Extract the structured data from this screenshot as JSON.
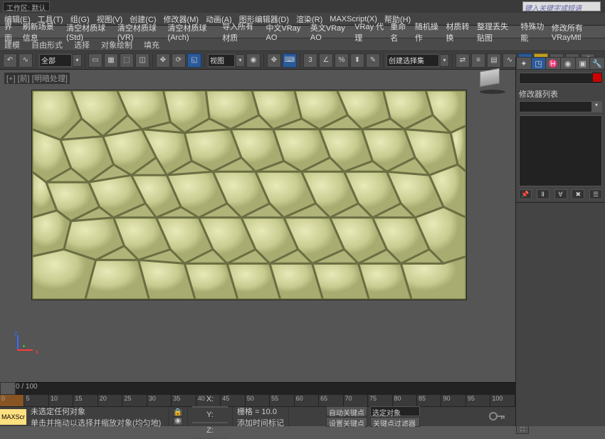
{
  "topbar": {
    "workspace_label": "工作区: 默认",
    "search_placeholder": "键入关键字或短语"
  },
  "menu": [
    "编辑(E)",
    "工具(T)",
    "组(G)",
    "视图(V)",
    "创建(C)",
    "修改器(M)",
    "动画(A)",
    "图形编辑器(D)",
    "渲染(R)",
    "MAXScript(X)",
    "帮助(H)"
  ],
  "secbar": [
    "界面",
    "刷新场景信息",
    "清空材质球(Std)",
    "清空材质球(VR)",
    "清空材质球(Arch)",
    "导入所有材质",
    "中文VRay AO",
    "英文VRay AO",
    "VRay 代理",
    "重命名",
    "随机操作",
    "材质转换",
    "整理丢失贴图",
    "特殊功能",
    "修改所有VRayMtl"
  ],
  "ribbon": {
    "tabs": [
      "建模",
      "自由形式",
      "选择",
      "对象绘制",
      "填充"
    ]
  },
  "toolbar": {
    "filter": "全部",
    "view_label": "视图",
    "selset_label": "创建选择集"
  },
  "viewport": {
    "label": "[+] [前] [明暗处理]"
  },
  "timeline": {
    "range": "0 / 100",
    "ticks": [
      "0",
      "5",
      "10",
      "15",
      "20",
      "25",
      "30",
      "35",
      "40",
      "45",
      "50",
      "55",
      "60",
      "65",
      "70",
      "75",
      "80",
      "85",
      "90",
      "95",
      "100"
    ]
  },
  "status": {
    "maxscript": "MAXScr",
    "line1": "未选定任何对象",
    "line2": "单击并拖动以选择并缩放对象(均匀地)",
    "grid": "栅格 = 10.0",
    "addtag": "添加时间标记",
    "autokey": "自动关键点",
    "setkey": "设置关键点",
    "selobj_label": "选定对象",
    "keyfilter": "关键点过滤器"
  },
  "coords": {
    "x": "X:",
    "y": "Y:",
    "z": "Z:"
  },
  "rpanel": {
    "modlist_label": "修改器列表"
  },
  "chart_data": null
}
